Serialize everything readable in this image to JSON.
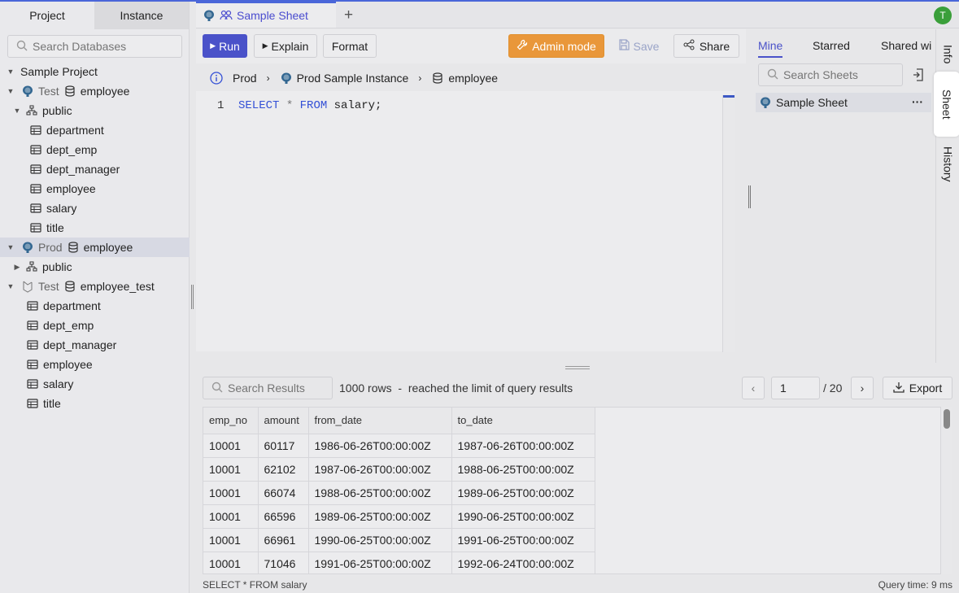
{
  "left_panel": {
    "tabs": [
      "Project",
      "Instance"
    ],
    "search_placeholder": "Search Databases",
    "tree": [
      {
        "label": "Sample Project"
      },
      {
        "env": "Test",
        "db": "employee"
      },
      {
        "label": "public"
      },
      {
        "label": "department"
      },
      {
        "label": "dept_emp"
      },
      {
        "label": "dept_manager"
      },
      {
        "label": "employee"
      },
      {
        "label": "salary"
      },
      {
        "label": "title"
      },
      {
        "env": "Prod",
        "db": "employee"
      },
      {
        "label": "public"
      },
      {
        "env": "Test",
        "db": "employee_test"
      },
      {
        "label": "department"
      },
      {
        "label": "dept_emp"
      },
      {
        "label": "dept_manager"
      },
      {
        "label": "employee"
      },
      {
        "label": "salary"
      },
      {
        "label": "title"
      }
    ]
  },
  "tab": {
    "title": "Sample Sheet",
    "add": "+"
  },
  "user": {
    "initial": "T"
  },
  "toolbar": {
    "run": "Run",
    "explain": "Explain",
    "format": "Format",
    "admin": "Admin mode",
    "save": "Save",
    "share": "Share"
  },
  "breadcrumb": {
    "env": "Prod",
    "instance": "Prod Sample Instance",
    "database": "employee"
  },
  "editor": {
    "line_number": "1"
  },
  "results": {
    "search_placeholder": "Search Results",
    "info": "1000 rows  -  reached the limit of query results",
    "page": "1",
    "page_total": "/ 20",
    "export": "Export",
    "columns": [
      "emp_no",
      "amount",
      "from_date",
      "to_date"
    ],
    "rows": [
      [
        "10001",
        "60117",
        "1986-06-26T00:00:00Z",
        "1987-06-26T00:00:00Z"
      ],
      [
        "10001",
        "62102",
        "1987-06-26T00:00:00Z",
        "1988-06-25T00:00:00Z"
      ],
      [
        "10001",
        "66074",
        "1988-06-25T00:00:00Z",
        "1989-06-25T00:00:00Z"
      ],
      [
        "10001",
        "66596",
        "1989-06-25T00:00:00Z",
        "1990-06-25T00:00:00Z"
      ],
      [
        "10001",
        "66961",
        "1990-06-25T00:00:00Z",
        "1991-06-25T00:00:00Z"
      ],
      [
        "10001",
        "71046",
        "1991-06-25T00:00:00Z",
        "1992-06-24T00:00:00Z"
      ]
    ]
  },
  "status": {
    "statement": "SELECT * FROM salary",
    "time": "Query time: 9 ms"
  },
  "sheets_panel": {
    "tabs": [
      "Mine",
      "Starred",
      "Shared wi"
    ],
    "search_placeholder": "Search Sheets",
    "item": "Sample Sheet",
    "more": "···"
  },
  "side_tabs": [
    "Info",
    "Sheet",
    "History"
  ],
  "colors": {
    "accent": "#4a52c9",
    "admin": "#e9973a",
    "keyword": "#3450d6"
  }
}
